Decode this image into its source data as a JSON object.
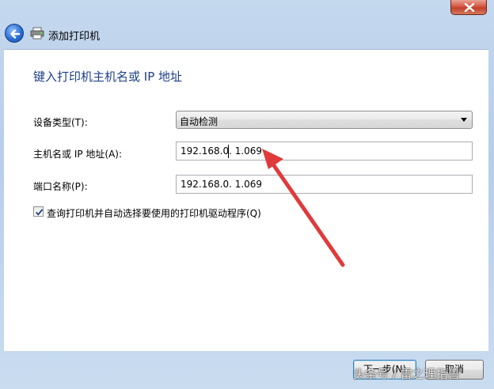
{
  "window": {
    "title": "添加打印机"
  },
  "page": {
    "heading": "键入打印机主机名或 IP 地址"
  },
  "form": {
    "device_type_label": "设备类型(T):",
    "device_type_value": "自动检测",
    "hostname_label": "主机名或 IP 地址(A):",
    "hostname_value": "192.168.0.  1.069",
    "port_label": "端口名称(P):",
    "port_value": "192.168.0.  1.069",
    "query_checkbox_label": "查询打印机并自动选择要使用的打印机驱动程序(Q)",
    "query_checkbox_checked": true
  },
  "buttons": {
    "next_label": "下一步(N)",
    "cancel_label": "取消"
  },
  "annotation": {
    "arrow_color": "#e03a3a"
  },
  "watermark": {
    "text": "头条号 / 雷之理指兽"
  },
  "icons": {
    "back": "back-arrow-icon",
    "printer": "printer-icon",
    "close": "close-icon",
    "dropdown": "chevron-down-icon",
    "check": "checkmark-icon"
  }
}
